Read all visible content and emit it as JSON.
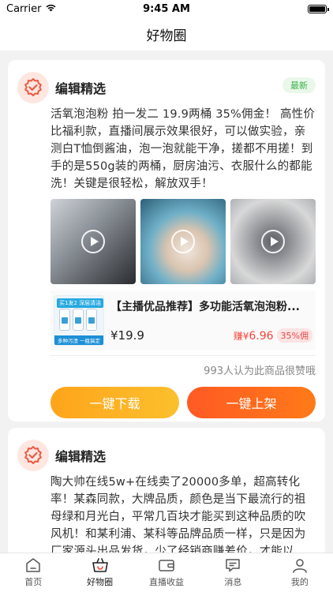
{
  "status_bar": {
    "carrier": "Carrier",
    "time": "9:45 AM"
  },
  "nav": {
    "title": "好物圈"
  },
  "posts": [
    {
      "author": "编辑精选",
      "badge": "最新",
      "text": "活氧泡泡粉 拍一发二 19.9两桶 35%佣金！ 高性价比福利款，直播间展示效果很好，可以做实验，亲测白T恤倒酱油，泡一泡就能干净，搓都不用搓！到手的是550g装的两桶，厨房油污、衣服什么的都能洗！关键是很轻松，解放双手！",
      "product": {
        "title": "【主播优品推荐】多功能活氧泡泡粉...",
        "price": "¥19.9",
        "earn_prefix": "赚¥",
        "earn_amount": "6.96",
        "commission": "35%佣",
        "img_top_text": "买1发2 深层清洁",
        "img_bottom_text": "多种污渍 一瓶搞定"
      },
      "likes": "993人认为此商品很赞哦",
      "download_label": "一键下载",
      "list_label": "一键上架"
    },
    {
      "author": "编辑精选",
      "text": "陶大帅在线5w+在线卖了20000多单，超高转化率！某森同款，大牌品质，颜色是当下最流行的祖母绿和月光白，平常几百块才能买到这种品质的吹风机！和某利浦、某科等品牌品质一样，只是因为厂家源头出品发货，少了经销商赚差价，才能以39.9的价格拿到"
    }
  ],
  "tabs": [
    {
      "label": "首页",
      "icon": "home-icon"
    },
    {
      "label": "好物圈",
      "icon": "basket-icon"
    },
    {
      "label": "直播收益",
      "icon": "wallet-icon"
    },
    {
      "label": "消息",
      "icon": "message-icon"
    },
    {
      "label": "我的",
      "icon": "profile-icon"
    }
  ],
  "colors": {
    "accent_orange": "#ff5a24",
    "accent_yellow": "#ffa41b",
    "price_red": "#f0463a",
    "badge_green": "#3cb34a",
    "tab_active": "#f0463a"
  }
}
